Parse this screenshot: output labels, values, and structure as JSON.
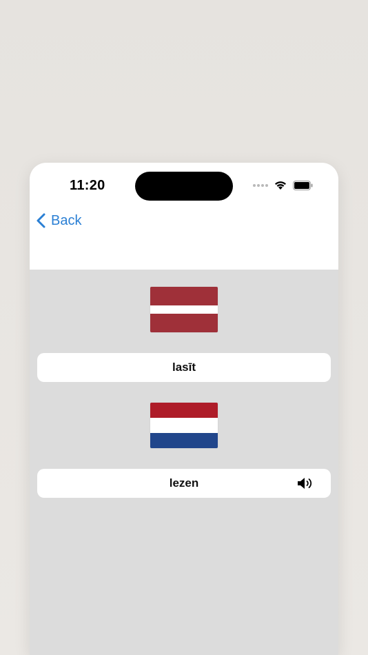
{
  "status_bar": {
    "time": "11:20"
  },
  "nav": {
    "back_label": "Back"
  },
  "source": {
    "flag": "latvia-flag",
    "word": "lasīt"
  },
  "target": {
    "flag": "netherlands-flag",
    "word": "lezen",
    "speaker_icon": "speaker-icon"
  },
  "colors": {
    "accent": "#2a7fd4",
    "content_bg": "#dcdcdc",
    "latvia_red": "#9f3039",
    "nl_red": "#ae1c28",
    "nl_blue": "#21468b"
  }
}
